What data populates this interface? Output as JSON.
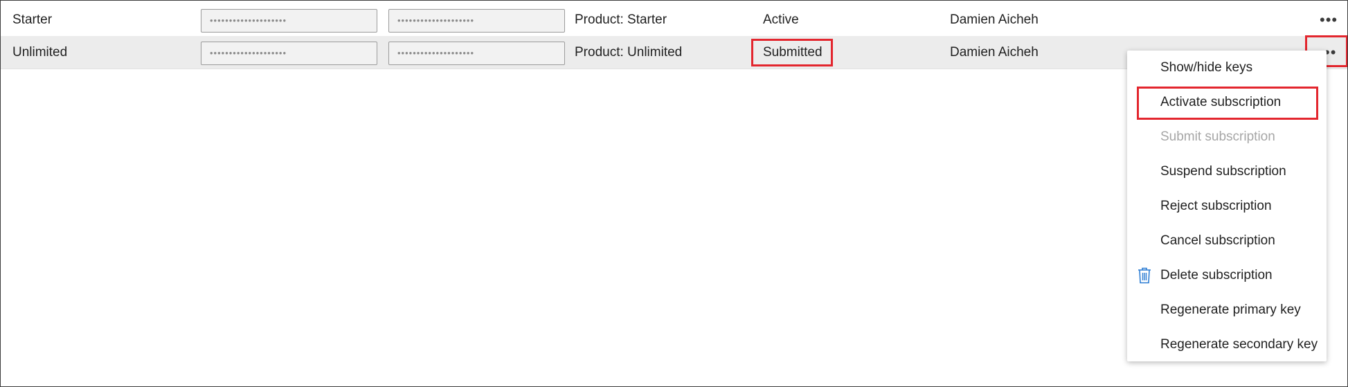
{
  "rows": [
    {
      "name": "Starter",
      "primary_key": "••••••••••••••••••••",
      "secondary_key": "••••••••••••••••••••",
      "scope": "Product: Starter",
      "state": "Active",
      "owner": "Damien Aicheh",
      "more_label": "•••"
    },
    {
      "name": "Unlimited",
      "primary_key": "••••••••••••••••••••",
      "secondary_key": "••••••••••••••••••••",
      "scope": "Product: Unlimited",
      "state": "Submitted",
      "owner": "Damien Aicheh",
      "more_label": "••"
    }
  ],
  "context_menu": {
    "items": [
      {
        "label": "Show/hide keys",
        "enabled": true
      },
      {
        "label": "Activate subscription",
        "enabled": true
      },
      {
        "label": "Submit subscription",
        "enabled": false
      },
      {
        "label": "Suspend subscription",
        "enabled": true
      },
      {
        "label": "Reject subscription",
        "enabled": true
      },
      {
        "label": "Cancel subscription",
        "enabled": true
      },
      {
        "label": "Delete subscription",
        "enabled": true,
        "icon": "trash-icon"
      },
      {
        "label": "Regenerate primary key",
        "enabled": true
      },
      {
        "label": "Regenerate secondary key",
        "enabled": true
      }
    ]
  },
  "colors": {
    "highlight": "#e3262e",
    "icon_blue": "#2b7cd3",
    "selected_row": "#ececec",
    "disabled_text": "#a6a6a6"
  }
}
